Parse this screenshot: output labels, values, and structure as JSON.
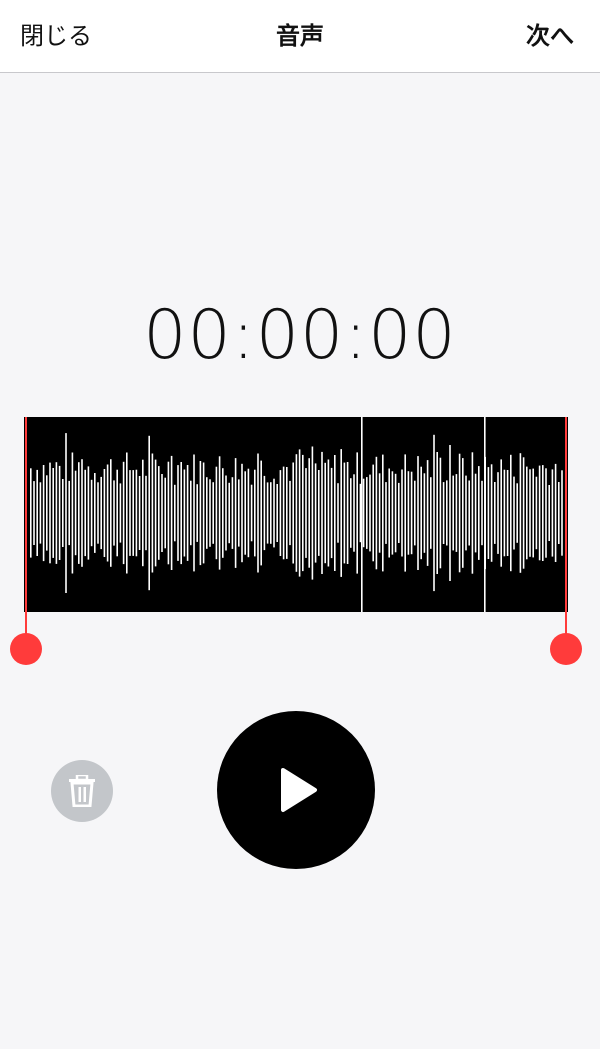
{
  "header": {
    "close_label": "閉じる",
    "title": "音声",
    "next_label": "次へ"
  },
  "timer": {
    "value": "00:00:00"
  },
  "waveform": {
    "trim_start_fraction": 0.0,
    "trim_end_fraction": 1.0,
    "colors": {
      "background": "#000000",
      "bars": "#ffffff",
      "trim_handles": "#ff3b3b"
    }
  },
  "controls": {
    "delete_icon": "trash-icon",
    "play_icon": "play-icon"
  }
}
